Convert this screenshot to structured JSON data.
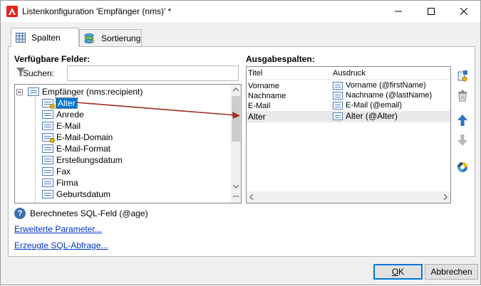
{
  "window": {
    "title": "Listenkonfiguration 'Empfänger (nms)' *",
    "accent_color": "#e8231a"
  },
  "tabs": [
    {
      "label": "Spalten",
      "active": true
    },
    {
      "label": "Sortierung",
      "active": false
    }
  ],
  "available": {
    "heading": "Verfügbare Felder:",
    "search_label": "Suchen:",
    "search_value": "",
    "root": "Empfänger (nms:recipient)",
    "items": [
      {
        "label": "Alter",
        "selected": true,
        "calculated": true
      },
      {
        "label": "Anrede",
        "selected": false,
        "calculated": false
      },
      {
        "label": "E-Mail",
        "selected": false,
        "calculated": false
      },
      {
        "label": "E-Mail-Domain",
        "selected": false,
        "calculated": true
      },
      {
        "label": "E-Mail-Format",
        "selected": false,
        "calculated": false
      },
      {
        "label": "Erstellungsdatum",
        "selected": false,
        "calculated": false
      },
      {
        "label": "Fax",
        "selected": false,
        "calculated": false
      },
      {
        "label": "Firma",
        "selected": false,
        "calculated": false
      },
      {
        "label": "Geburtsdatum",
        "selected": false,
        "calculated": false
      }
    ]
  },
  "output": {
    "heading": "Ausgabespalten:",
    "col_title": "Titel",
    "col_expr": "Ausdruck",
    "rows": [
      {
        "title": "Vorname",
        "expr": "Vorname (@firstName)"
      },
      {
        "title": "Nachname",
        "expr": "Nachname (@lastName)"
      },
      {
        "title": "E-Mail",
        "expr": "E-Mail (@email)"
      },
      {
        "title": "Alter",
        "expr": "Alter (@Alter)"
      }
    ]
  },
  "info": {
    "calc_field": "Berechnetes SQL-Feld (@age)",
    "help_glyph": "?",
    "link_params": "Erweiterte Parameter...",
    "link_sql": "Erzeugte SQL-Abfrage..."
  },
  "buttons": {
    "ok_first": "O",
    "ok_rest": "K",
    "cancel": "Abbrechen"
  }
}
